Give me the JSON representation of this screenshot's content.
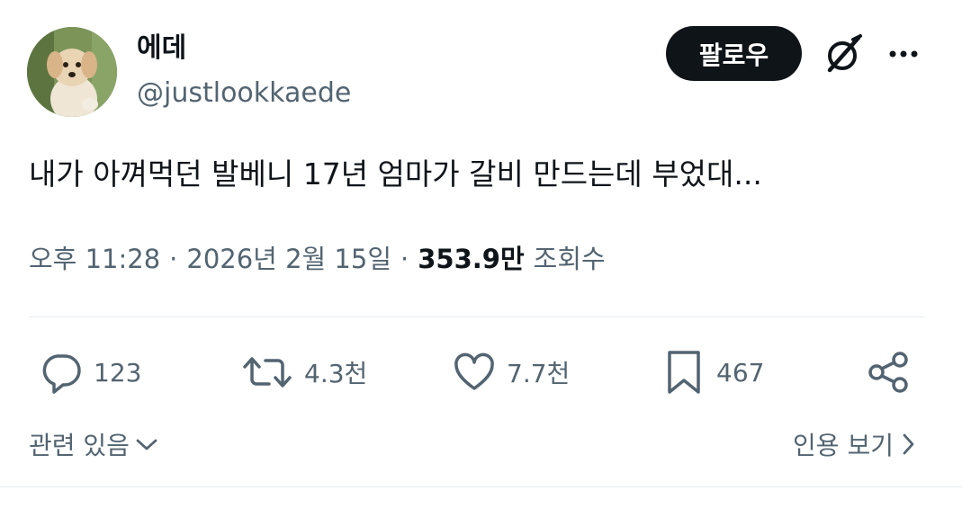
{
  "author": {
    "display_name": "에데",
    "handle": "@justlookkaede"
  },
  "header": {
    "follow_label": "팔로우"
  },
  "tweet": {
    "text": "내가 아껴먹던 발베니 17년 엄마가 갈비 만드는데 부었대..."
  },
  "meta": {
    "time": "오후 11:28",
    "separator": "·",
    "date": "2026년 2월 15일",
    "views_count": "353.9만",
    "views_label": "조회수"
  },
  "actions": {
    "replies": "123",
    "retweets": "4.3천",
    "likes": "7.7천",
    "bookmarks": "467"
  },
  "footer": {
    "related_label": "관련 있음",
    "quotes_label": "인용 보기"
  },
  "colors": {
    "text_primary": "#0f1419",
    "text_secondary": "#536471",
    "follow_bg": "#0f1419",
    "divider": "#e6ecf0"
  },
  "icons": [
    "grok-icon",
    "more-icon",
    "reply-icon",
    "retweet-icon",
    "like-icon",
    "bookmark-icon",
    "share-icon",
    "chevron-down-icon",
    "chevron-right-icon"
  ]
}
